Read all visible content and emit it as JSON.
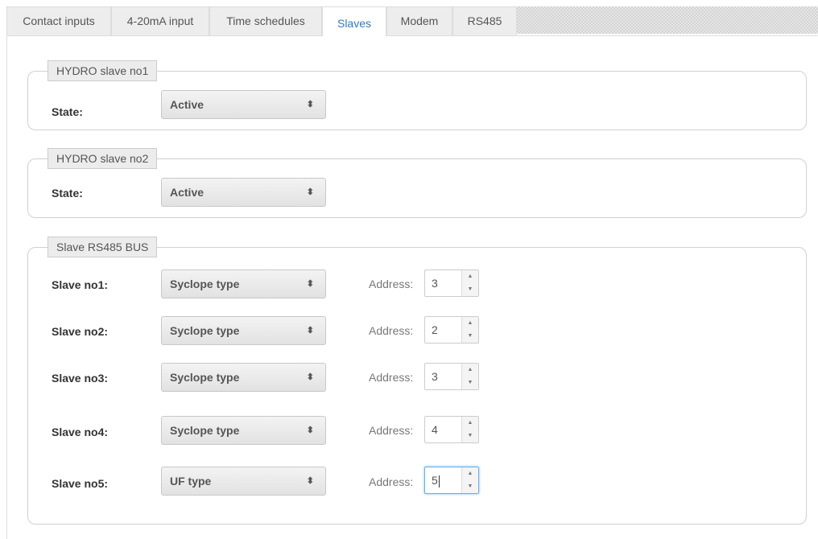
{
  "tabs": [
    {
      "label": "Contact inputs",
      "active": false
    },
    {
      "label": "4-20mA input",
      "active": false
    },
    {
      "label": "Time schedules",
      "active": false
    },
    {
      "label": "Slaves",
      "active": true
    },
    {
      "label": "Modem",
      "active": false
    },
    {
      "label": "RS485",
      "active": false
    }
  ],
  "hydro1": {
    "legend": "HYDRO slave no1",
    "state_label": "State:",
    "state_value": "Active"
  },
  "hydro2": {
    "legend": "HYDRO slave no2",
    "state_label": "State:",
    "state_value": "Active"
  },
  "bus": {
    "legend": "Slave RS485 BUS",
    "address_label": "Address:",
    "slaves": [
      {
        "label": "Slave no1:",
        "type": "Syclope type",
        "address": "3"
      },
      {
        "label": "Slave no2:",
        "type": "Syclope type",
        "address": "2"
      },
      {
        "label": "Slave no3:",
        "type": "Syclope type",
        "address": "3"
      },
      {
        "label": "Slave no4:",
        "type": "Syclope type",
        "address": "4"
      },
      {
        "label": "Slave no5:",
        "type": "UF type",
        "address": "5"
      }
    ]
  },
  "icons": {
    "select_arrows": "⬍",
    "spin_up": "▲",
    "spin_down": "▼"
  },
  "colors": {
    "active_tab_text": "#337ab7",
    "focus_border": "#66afe9"
  }
}
